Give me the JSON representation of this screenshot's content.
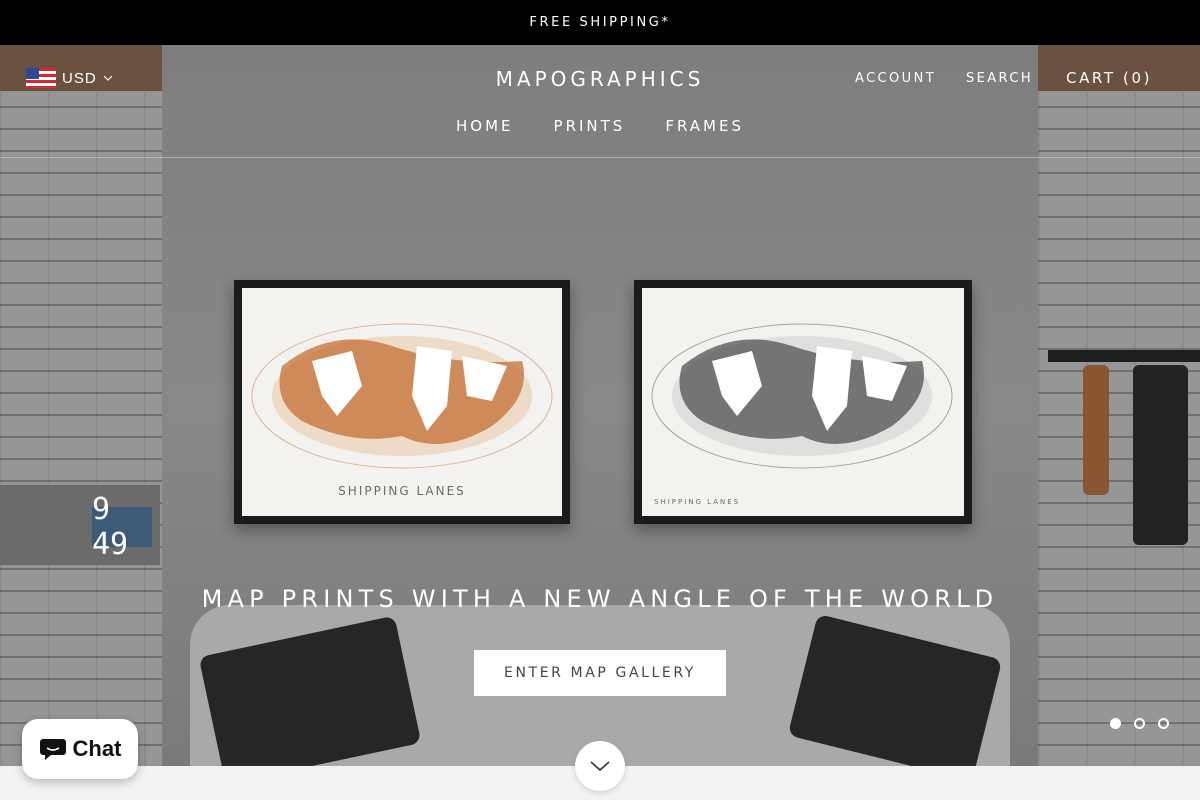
{
  "announcement": {
    "text": "FREE SHIPPING*"
  },
  "header": {
    "currency": {
      "code": "USD",
      "flag_icon": "us-flag-icon"
    },
    "logo": "MAPOGRAPHICS",
    "account": "ACCOUNT",
    "search": "SEARCH",
    "cart": "CART (0)"
  },
  "nav": {
    "items": [
      {
        "label": "HOME"
      },
      {
        "label": "PRINTS"
      },
      {
        "label": "FRAMES"
      }
    ]
  },
  "hero": {
    "print_left_title": "SHIPPING LANES",
    "print_right_title": "SHIPPING LANES",
    "heading": "MAP PRINTS WITH A NEW ANGLE OF THE WORLD",
    "cta": "ENTER MAP GALLERY",
    "slides": {
      "count": 3,
      "active": 1
    },
    "clock_text": "9 49",
    "map_colors": {
      "left": "#b8672a",
      "right": "#2d2d2d"
    }
  },
  "chat": {
    "label": "Chat",
    "icon": "chat-bubble-icon"
  },
  "scroll": {
    "icon": "chevron-down-icon"
  }
}
